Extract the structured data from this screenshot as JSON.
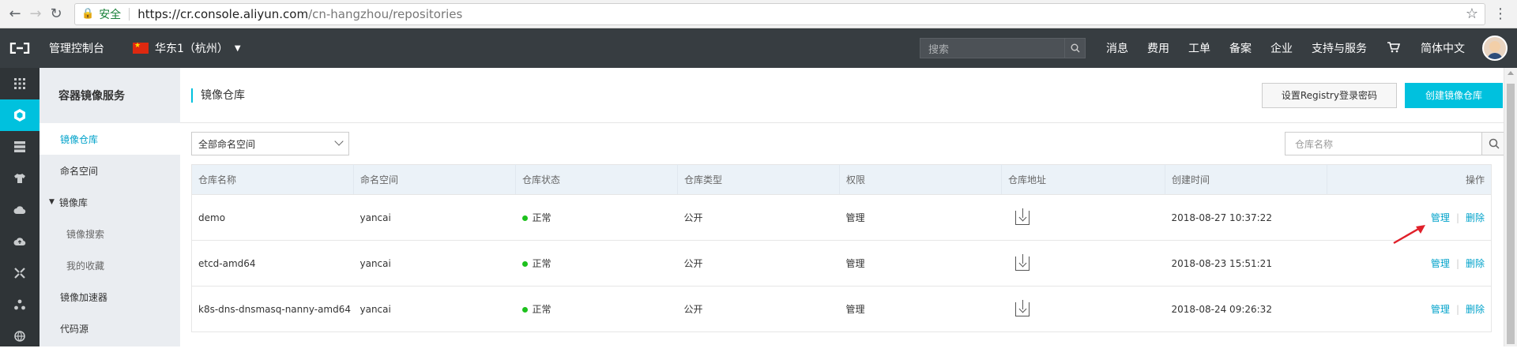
{
  "browser": {
    "secure_label": "安全",
    "url_host": "https://cr.console.aliyun.com",
    "url_path": "/cn-hangzhou/repositories"
  },
  "topnav": {
    "console_title": "管理控制台",
    "region": "华东1（杭州）",
    "search_placeholder": "搜索",
    "links": [
      "消息",
      "费用",
      "工单",
      "备案",
      "企业",
      "支持与服务"
    ],
    "language": "简体中文"
  },
  "sidebar": {
    "title": "容器镜像服务",
    "items": [
      {
        "label": "镜像仓库"
      },
      {
        "label": "命名空间"
      },
      {
        "label": "镜像库"
      },
      {
        "label": "镜像搜索"
      },
      {
        "label": "我的收藏"
      },
      {
        "label": "镜像加速器"
      },
      {
        "label": "代码源"
      }
    ]
  },
  "page": {
    "title": "镜像仓库",
    "btn_registry_password": "设置Registry登录密码",
    "btn_create_repo": "创建镜像仓库",
    "namespace_select": "全部命名空间",
    "repo_search_placeholder": "仓库名称"
  },
  "table": {
    "headers": [
      "仓库名称",
      "命名空间",
      "仓库状态",
      "仓库类型",
      "权限",
      "仓库地址",
      "创建时间",
      "操作"
    ],
    "rows": [
      {
        "name": "demo",
        "namespace": "yancai",
        "status": "正常",
        "type": "公开",
        "permission": "管理",
        "created": "2018-08-27 10:37:22",
        "op_manage": "管理",
        "op_delete": "删除"
      },
      {
        "name": "etcd-amd64",
        "namespace": "yancai",
        "status": "正常",
        "type": "公开",
        "permission": "管理",
        "created": "2018-08-23 15:51:21",
        "op_manage": "管理",
        "op_delete": "删除"
      },
      {
        "name": "k8s-dns-dnsmasq-nanny-amd64",
        "namespace": "yancai",
        "status": "正常",
        "type": "公开",
        "permission": "管理",
        "created": "2018-08-24 09:26:32",
        "op_manage": "管理",
        "op_delete": "删除"
      }
    ]
  },
  "colors": {
    "accent": "#00c1de",
    "link": "#00a2ca",
    "status_ok": "#1dc11d",
    "topnav_bg": "#373d41",
    "annotation_arrow": "#e0202a"
  }
}
